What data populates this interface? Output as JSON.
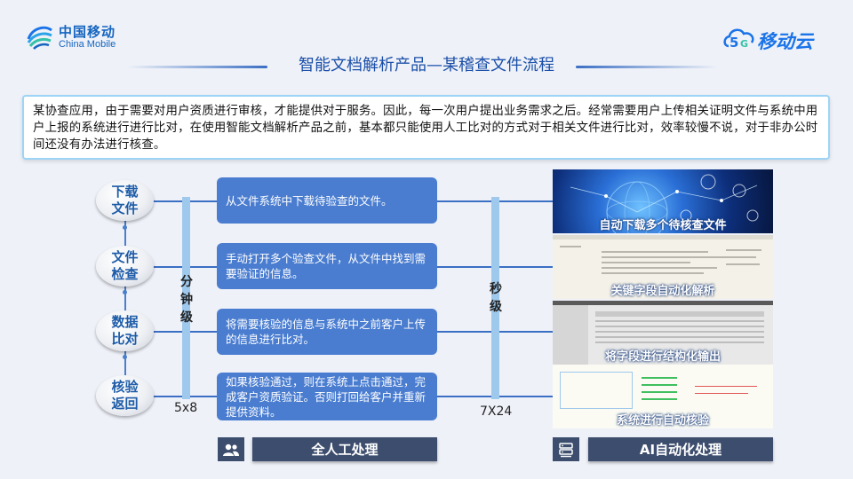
{
  "brand": {
    "china_mobile_cn": "中国移动",
    "china_mobile_en": "China Mobile",
    "cloud_logo_text": "移动云"
  },
  "title": "智能文档解析产品—某稽查文件流程",
  "intro": "某协查应用，由于需要对用户资质进行审核，才能提供对于服务。因此，每一次用户提出业务需求之后。经常需要用户上传相关证明文件与系统中用户上报的系统进行进行比对，在使用智能文档解析产品之前，基本都只能使用人工比对的方式对于相关文件进行比对，效率较慢不说，对于非办公时间还没有办法进行核查。",
  "steps": [
    {
      "label": "下载\n文件",
      "desc": "从文件系统中下载待验查的文件。"
    },
    {
      "label": "文件\n检查",
      "desc": "手动打开多个验查文件，从文件中找到需要验证的信息。"
    },
    {
      "label": "数据\n比对",
      "desc": "将需要核验的信息与系统中之前客户上传的信息进行比对。"
    },
    {
      "label": "核验\n返回",
      "desc": "如果核验通过，则在系统上点击通过，完成客户资质验证。否则打回给客户并重新提供资料。"
    }
  ],
  "manual": {
    "speed": "分钟级",
    "rate": "5x8",
    "footer": "全人工处理",
    "icon": "users-icon"
  },
  "ai": {
    "speed": "秒级",
    "rate": "7X24",
    "footer": "AI自动化处理",
    "icon": "server-icon",
    "captions": [
      "自动下载多个待核查文件",
      "关键字段自动化解析",
      "将字段进行结构化输出",
      "系统进行自动核验"
    ]
  },
  "colors": {
    "primary": "#4a7dd0",
    "title": "#1a4fa8",
    "footer": "#3d4d6d",
    "bar": "#9ec8ec"
  }
}
